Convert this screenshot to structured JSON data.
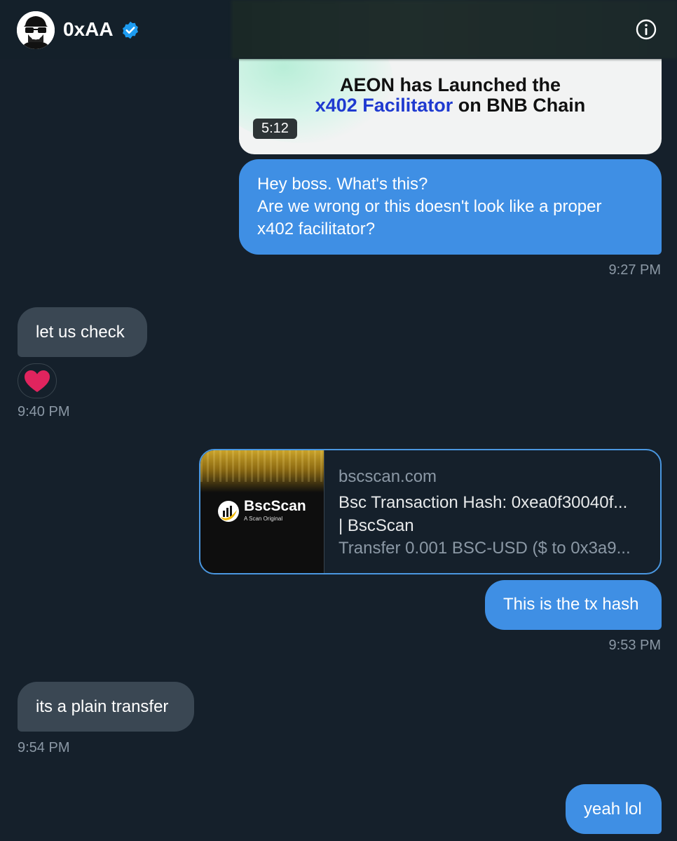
{
  "header": {
    "name": "0xAA",
    "verified_icon": "verified-badge-icon",
    "info_icon": "info-icon",
    "accent": "#1d9bf0"
  },
  "video": {
    "title_line1": "AEON has Launched the",
    "title_line2_highlight": "x402 Facilitator",
    "title_line2_rest": " on BNB Chain",
    "duration": "5:12"
  },
  "messages": [
    {
      "direction": "out",
      "lines": [
        "Hey boss. What's this?",
        "Are we wrong or this doesn't look like a proper",
        "x402 facilitator?"
      ],
      "time": "9:27 PM"
    },
    {
      "direction": "in",
      "text": "let us check",
      "reaction": "heart-icon",
      "time": "9:40 PM"
    },
    {
      "direction": "out",
      "text": "This is the tx hash",
      "time": "9:53 PM"
    },
    {
      "direction": "in",
      "text": "its a plain transfer",
      "time": "9:54 PM"
    },
    {
      "direction": "out",
      "text": "yeah lol"
    }
  ],
  "link_card": {
    "thumb_brand": "BscScan",
    "thumb_tagline": "A Scan Original",
    "domain": "bscscan.com",
    "title_line1": "Bsc Transaction Hash: 0xea0f30040f...",
    "title_line2": "| BscScan",
    "description": "Transfer 0.001 BSC-USD ($ to 0x3a9..."
  },
  "colors": {
    "background": "#15202b",
    "outgoing_bubble": "#3f8fe4",
    "incoming_bubble": "#3a4753",
    "timestamp": "#8b98a5",
    "heart": "#f91880"
  }
}
